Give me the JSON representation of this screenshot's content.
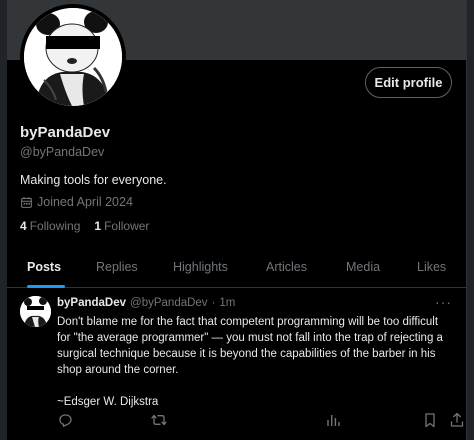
{
  "profile": {
    "display_name": "byPandaDev",
    "handle": "@byPandaDev",
    "bio": "Making tools for everyone.",
    "joined": "Joined April 2024",
    "following_count": "4",
    "following_label": "Following",
    "followers_count": "1",
    "followers_label": "Follower",
    "edit_label": "Edit profile"
  },
  "tabs": [
    {
      "label": "Posts",
      "active": true
    },
    {
      "label": "Replies",
      "active": false
    },
    {
      "label": "Highlights",
      "active": false
    },
    {
      "label": "Articles",
      "active": false
    },
    {
      "label": "Media",
      "active": false
    },
    {
      "label": "Likes",
      "active": false
    }
  ],
  "tweet": {
    "author_name": "byPandaDev",
    "author_handle": "@byPandaDev",
    "separator": "·",
    "time": "1m",
    "more": "···",
    "text": "Don't blame me for the fact that competent programming will be too difficult for \"the average programmer\" — you must not fall into the trap of rejecting a surgical technique because it is beyond the capabilities of the barber in his shop around the corner.",
    "attribution": "~Edsger W. Dijkstra"
  },
  "icons": {
    "calendar": "calendar-icon",
    "reply": "reply-icon",
    "repost": "repost-icon",
    "analytics": "analytics-icon",
    "bookmark": "bookmark-icon",
    "share": "share-icon"
  },
  "colors": {
    "accent": "#1d9bf0",
    "background": "#000000",
    "text": "#e7e9ea",
    "muted": "#71767b",
    "border": "#2f3336",
    "banner": "#333639"
  }
}
